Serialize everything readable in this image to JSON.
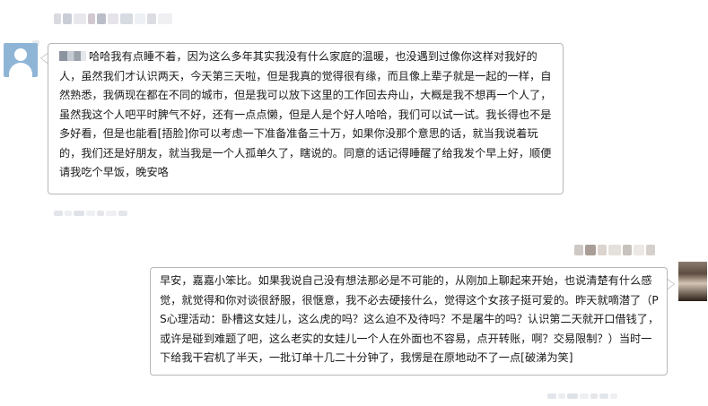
{
  "incoming_message": {
    "text": "哈哈我有点睡不着，因为这么多年其实我没有什么家庭的温暖，也没遇到过像你这样对我好的人，虽然我们才认识两天，今天第三天啦，但是我真的觉得很有缘，而且像上辈子就是一起的一样，自然熟悉，我俩现在都在不同的城市，但是我可以放下这里的工作回去舟山，大概是我不想再一个人了，虽然我这个人吧平时脾气不好，还有一点点懒，但是人是个好人哈哈，我们可以试一试。我长得也不是多好看，但是也能看[捂脸]你可以考虑一下准备准备三十万，如果你没那个意思的话，就当我说着玩的，我们还是好朋友，就当我是一个人孤单久了，瞎说的。同意的话记得睡醒了给我发个早上好，顺便请我吃个早饭，晚安咯"
  },
  "outgoing_message": {
    "text": "早安，嘉嘉小笨比。如果我说自己没有想法那必是不可能的，从刚加上聊起来开始，也说清楚有什么感觉，就觉得和你对谈很舒服，很惬意，我不必去硬接什么，觉得这个女孩子挺可爱的。昨天就嘀潜了（PS心理活动：卧槽这女娃儿，这么虎的吗？这么迫不及待吗？不是屠牛的吗？认识第二天就开口借钱了，或许是碰到难题了吧，这么老实的女娃儿一个人在外面也不容易，点开转账，啊？交易限制？）当时一下给我干宕机了半天，一批订单十几二十分钟了，我愣是在原地动不了一点[破涕为笑]"
  },
  "colors": {
    "bubble_border": "#b7b7b7",
    "avatar_default": "#8fb5d6",
    "text": "#1a1a1a"
  },
  "icons": {
    "left_avatar": "default-user-avatar-icon",
    "right_avatar": "user-photo-avatar"
  }
}
